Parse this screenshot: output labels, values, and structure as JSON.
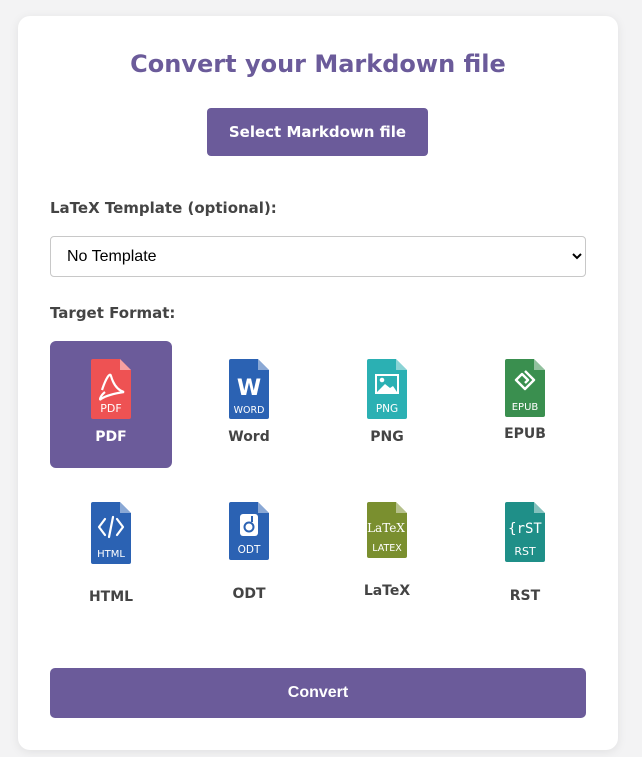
{
  "page": {
    "title": "Convert your Markdown file",
    "select_button": "Select Markdown file",
    "template_label": "LaTeX Template (optional):",
    "template_selected": "No Template",
    "target_label": "Target Format:",
    "convert_button": "Convert"
  },
  "formats": [
    {
      "name": "PDF",
      "badge": "PDF",
      "color": "#ee5253",
      "icon": "pdf-icon",
      "selected": true
    },
    {
      "name": "Word",
      "badge": "WORD",
      "color": "#2b62b3",
      "icon": "word-icon",
      "selected": false
    },
    {
      "name": "PNG",
      "badge": "PNG",
      "color": "#2bb0b3",
      "icon": "png-icon",
      "selected": false
    },
    {
      "name": "EPUB",
      "badge": "EPUB",
      "color": "#3a8f4f",
      "icon": "epub-icon",
      "selected": false
    },
    {
      "name": "HTML",
      "badge": "HTML",
      "color": "#2b62b3",
      "icon": "html-icon",
      "selected": false
    },
    {
      "name": "ODT",
      "badge": "ODT",
      "color": "#2b62b3",
      "icon": "odt-icon",
      "selected": false
    },
    {
      "name": "LaTeX",
      "badge": "LATEX",
      "color": "#7a8f2f",
      "icon": "latex-icon",
      "selected": false
    },
    {
      "name": "RST",
      "badge": "RST",
      "color": "#1f8f88",
      "icon": "rst-icon",
      "selected": false
    }
  ],
  "colors": {
    "accent": "#6b5b9a",
    "background": "#f3f3f4"
  }
}
